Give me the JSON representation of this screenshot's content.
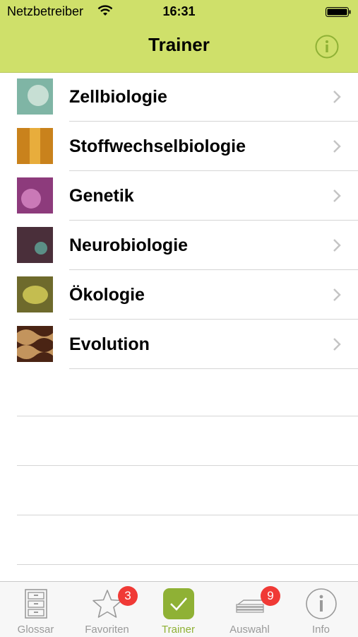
{
  "status_bar": {
    "carrier": "Netzbetreiber",
    "time": "16:31"
  },
  "nav": {
    "title": "Trainer"
  },
  "topics": [
    {
      "label": "Zellbiologie",
      "thumb_colors": [
        "#7fb5a5",
        "#d9eae0"
      ]
    },
    {
      "label": "Stoffwechselbiologie",
      "thumb_colors": [
        "#c9821c",
        "#f0b845"
      ]
    },
    {
      "label": "Genetik",
      "thumb_colors": [
        "#8d3b7c",
        "#d98ac6"
      ]
    },
    {
      "label": "Neurobiologie",
      "thumb_colors": [
        "#4a2f3a",
        "#5fa89a"
      ]
    },
    {
      "label": "Ökologie",
      "thumb_colors": [
        "#6e6a2c",
        "#d9d25a"
      ]
    },
    {
      "label": "Evolution",
      "thumb_colors": [
        "#4a2414",
        "#d8a86a"
      ]
    }
  ],
  "tabs": [
    {
      "label": "Glossar",
      "icon": "cabinet-icon",
      "badge": ""
    },
    {
      "label": "Favoriten",
      "icon": "star-icon",
      "badge": "3"
    },
    {
      "label": "Trainer",
      "icon": "check-icon",
      "badge": "",
      "active": true
    },
    {
      "label": "Auswahl",
      "icon": "stack-icon",
      "badge": "9"
    },
    {
      "label": "Info",
      "icon": "info-icon",
      "badge": ""
    }
  ],
  "colors": {
    "accent": "#cfe06a",
    "active_tab": "#8fb135",
    "badge": "#f03a36"
  }
}
